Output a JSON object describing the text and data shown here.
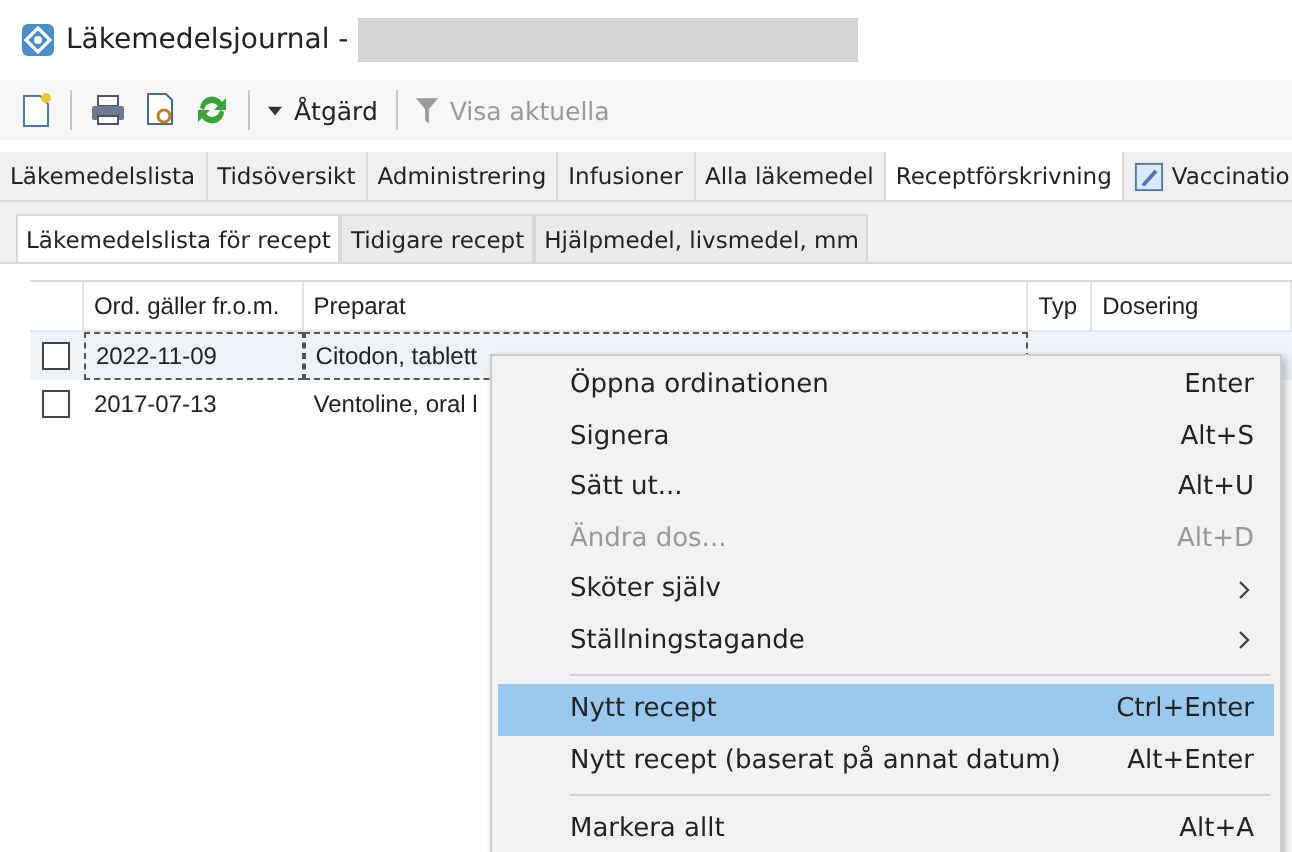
{
  "window": {
    "title": "Läkemedelsjournal -"
  },
  "toolbar": {
    "action_button": "Åtgärd",
    "filter_button": {
      "label": "Visa aktuella",
      "disabled": true
    }
  },
  "tabs": [
    {
      "label": "Läkemedelslista",
      "selected": false
    },
    {
      "label": "Tidsöversikt",
      "selected": false
    },
    {
      "label": "Administrering",
      "selected": false
    },
    {
      "label": "Infusioner",
      "selected": false
    },
    {
      "label": "Alla läkemedel",
      "selected": false
    },
    {
      "label": "Receptförskrivning",
      "selected": true
    },
    {
      "label": "Vaccinatio",
      "selected": false,
      "icon": true
    }
  ],
  "subtabs": [
    {
      "label": "Läkemedelslista för recept",
      "selected": true
    },
    {
      "label": "Tidigare recept",
      "selected": false
    },
    {
      "label": "Hjälpmedel, livsmedel, mm",
      "selected": false
    }
  ],
  "table": {
    "columns": [
      "Ord. gäller fr.o.m.",
      "Preparat",
      "Typ",
      "Dosering"
    ],
    "rows": [
      {
        "checked": false,
        "selected": true,
        "cells": [
          "2022-11-09",
          "Citodon, tablett",
          "",
          ""
        ]
      },
      {
        "checked": false,
        "selected": false,
        "cells": [
          "2017-07-13",
          "Ventoline, oral l",
          "",
          ""
        ]
      }
    ]
  },
  "context_menu": [
    {
      "kind": "item",
      "label": "Öppna ordinationen",
      "shortcut": "Enter",
      "disabled": false,
      "selected": false,
      "submenu": false
    },
    {
      "kind": "item",
      "label": "Signera",
      "shortcut": "Alt+S",
      "disabled": false,
      "selected": false,
      "submenu": false
    },
    {
      "kind": "item",
      "label": "Sätt ut...",
      "shortcut": "Alt+U",
      "disabled": false,
      "selected": false,
      "submenu": false
    },
    {
      "kind": "item",
      "label": "Ändra dos...",
      "shortcut": "Alt+D",
      "disabled": true,
      "selected": false,
      "submenu": false
    },
    {
      "kind": "item",
      "label": "Sköter själv",
      "disabled": false,
      "selected": false,
      "submenu": true
    },
    {
      "kind": "item",
      "label": "Ställningstagande",
      "disabled": false,
      "selected": false,
      "submenu": true
    },
    {
      "kind": "separator"
    },
    {
      "kind": "item",
      "label": "Nytt recept",
      "shortcut": "Ctrl+Enter",
      "disabled": false,
      "selected": true,
      "submenu": false
    },
    {
      "kind": "item",
      "label": "Nytt recept (baserat på annat datum)",
      "shortcut": "Alt+Enter",
      "disabled": false,
      "selected": false,
      "submenu": false
    },
    {
      "kind": "separator"
    },
    {
      "kind": "item",
      "label": "Markera allt",
      "shortcut": "Alt+A",
      "disabled": false,
      "selected": false,
      "submenu": false
    }
  ]
}
